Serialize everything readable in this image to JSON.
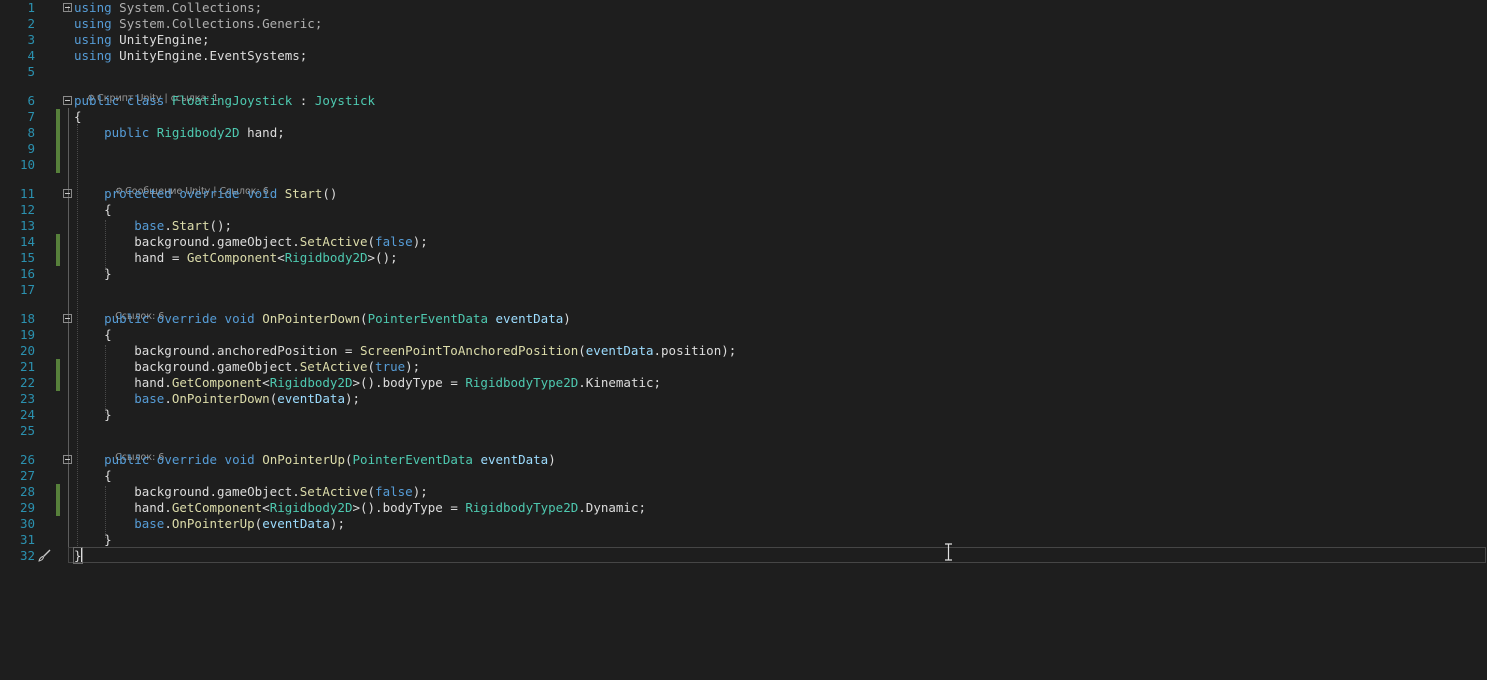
{
  "editor": {
    "lines": [
      {
        "n": "1",
        "tokens": [
          {
            "t": "using",
            "c": "kw"
          },
          {
            "t": " System.Collections;",
            "c": "dim"
          }
        ]
      },
      {
        "n": "2",
        "tokens": [
          {
            "t": "using",
            "c": "kw"
          },
          {
            "t": " System.Collections.Generic;",
            "c": "dim"
          }
        ]
      },
      {
        "n": "3",
        "tokens": [
          {
            "t": "using",
            "c": "kw"
          },
          {
            "t": " UnityEngine;",
            "c": ""
          }
        ]
      },
      {
        "n": "4",
        "tokens": [
          {
            "t": "using",
            "c": "kw"
          },
          {
            "t": " UnityEngine.EventSystems;",
            "c": ""
          }
        ]
      },
      {
        "n": "5",
        "tokens": []
      },
      {
        "n": "6",
        "tokens": [
          {
            "t": "public",
            "c": "kw"
          },
          {
            "t": " ",
            "c": ""
          },
          {
            "t": "class",
            "c": "kw"
          },
          {
            "t": " ",
            "c": ""
          },
          {
            "t": "FloatingJoystick",
            "c": "ty"
          },
          {
            "t": " : ",
            "c": ""
          },
          {
            "t": "Joystick",
            "c": "ty"
          }
        ]
      },
      {
        "n": "7",
        "tokens": [
          {
            "t": "{",
            "c": ""
          }
        ]
      },
      {
        "n": "8",
        "tokens": [
          {
            "t": "    ",
            "c": ""
          },
          {
            "t": "public",
            "c": "kw"
          },
          {
            "t": " ",
            "c": ""
          },
          {
            "t": "Rigidbody2D",
            "c": "ty"
          },
          {
            "t": " hand;",
            "c": ""
          }
        ]
      },
      {
        "n": "9",
        "tokens": []
      },
      {
        "n": "10",
        "tokens": []
      },
      {
        "n": "11",
        "tokens": [
          {
            "t": "    ",
            "c": ""
          },
          {
            "t": "protected",
            "c": "kw"
          },
          {
            "t": " ",
            "c": ""
          },
          {
            "t": "override",
            "c": "kw"
          },
          {
            "t": " ",
            "c": ""
          },
          {
            "t": "void",
            "c": "kw"
          },
          {
            "t": " ",
            "c": ""
          },
          {
            "t": "Start",
            "c": "fn"
          },
          {
            "t": "()",
            "c": ""
          }
        ]
      },
      {
        "n": "12",
        "tokens": [
          {
            "t": "    {",
            "c": ""
          }
        ]
      },
      {
        "n": "13",
        "tokens": [
          {
            "t": "        ",
            "c": ""
          },
          {
            "t": "base",
            "c": "kw"
          },
          {
            "t": ".",
            "c": ""
          },
          {
            "t": "Start",
            "c": "fn"
          },
          {
            "t": "();",
            "c": ""
          }
        ]
      },
      {
        "n": "14",
        "tokens": [
          {
            "t": "        background.gameObject.",
            "c": ""
          },
          {
            "t": "SetActive",
            "c": "fn"
          },
          {
            "t": "(",
            "c": ""
          },
          {
            "t": "false",
            "c": "kw"
          },
          {
            "t": ");",
            "c": ""
          }
        ]
      },
      {
        "n": "15",
        "tokens": [
          {
            "t": "        hand = ",
            "c": ""
          },
          {
            "t": "GetComponent",
            "c": "fn"
          },
          {
            "t": "<",
            "c": ""
          },
          {
            "t": "Rigidbody2D",
            "c": "ty"
          },
          {
            "t": ">();",
            "c": ""
          }
        ]
      },
      {
        "n": "16",
        "tokens": [
          {
            "t": "    }",
            "c": ""
          }
        ]
      },
      {
        "n": "17",
        "tokens": []
      },
      {
        "n": "18",
        "tokens": [
          {
            "t": "    ",
            "c": ""
          },
          {
            "t": "public",
            "c": "kw"
          },
          {
            "t": " ",
            "c": ""
          },
          {
            "t": "override",
            "c": "kw"
          },
          {
            "t": " ",
            "c": ""
          },
          {
            "t": "void",
            "c": "kw"
          },
          {
            "t": " ",
            "c": ""
          },
          {
            "t": "OnPointerDown",
            "c": "fn"
          },
          {
            "t": "(",
            "c": ""
          },
          {
            "t": "PointerEventData",
            "c": "ty"
          },
          {
            "t": " ",
            "c": ""
          },
          {
            "t": "eventData",
            "c": "pm"
          },
          {
            "t": ")",
            "c": ""
          }
        ]
      },
      {
        "n": "19",
        "tokens": [
          {
            "t": "    {",
            "c": ""
          }
        ]
      },
      {
        "n": "20",
        "tokens": [
          {
            "t": "        background.anchoredPosition = ",
            "c": ""
          },
          {
            "t": "ScreenPointToAnchoredPosition",
            "c": "fn"
          },
          {
            "t": "(",
            "c": ""
          },
          {
            "t": "eventData",
            "c": "pm"
          },
          {
            "t": ".position);",
            "c": ""
          }
        ]
      },
      {
        "n": "21",
        "tokens": [
          {
            "t": "        background.gameObject.",
            "c": ""
          },
          {
            "t": "SetActive",
            "c": "fn"
          },
          {
            "t": "(",
            "c": ""
          },
          {
            "t": "true",
            "c": "kw"
          },
          {
            "t": ");",
            "c": ""
          }
        ]
      },
      {
        "n": "22",
        "tokens": [
          {
            "t": "        hand.",
            "c": ""
          },
          {
            "t": "GetComponent",
            "c": "fn"
          },
          {
            "t": "<",
            "c": ""
          },
          {
            "t": "Rigidbody2D",
            "c": "ty"
          },
          {
            "t": ">().bodyType = ",
            "c": ""
          },
          {
            "t": "RigidbodyType2D",
            "c": "ty"
          },
          {
            "t": ".Kinematic;",
            "c": ""
          }
        ]
      },
      {
        "n": "23",
        "tokens": [
          {
            "t": "        ",
            "c": ""
          },
          {
            "t": "base",
            "c": "kw"
          },
          {
            "t": ".",
            "c": ""
          },
          {
            "t": "OnPointerDown",
            "c": "fn"
          },
          {
            "t": "(",
            "c": ""
          },
          {
            "t": "eventData",
            "c": "pm"
          },
          {
            "t": ");",
            "c": ""
          }
        ]
      },
      {
        "n": "24",
        "tokens": [
          {
            "t": "    }",
            "c": ""
          }
        ]
      },
      {
        "n": "25",
        "tokens": []
      },
      {
        "n": "26",
        "tokens": [
          {
            "t": "    ",
            "c": ""
          },
          {
            "t": "public",
            "c": "kw"
          },
          {
            "t": " ",
            "c": ""
          },
          {
            "t": "override",
            "c": "kw"
          },
          {
            "t": " ",
            "c": ""
          },
          {
            "t": "void",
            "c": "kw"
          },
          {
            "t": " ",
            "c": ""
          },
          {
            "t": "OnPointerUp",
            "c": "fn"
          },
          {
            "t": "(",
            "c": ""
          },
          {
            "t": "PointerEventData",
            "c": "ty"
          },
          {
            "t": " ",
            "c": ""
          },
          {
            "t": "eventData",
            "c": "pm"
          },
          {
            "t": ")",
            "c": ""
          }
        ]
      },
      {
        "n": "27",
        "tokens": [
          {
            "t": "    {",
            "c": ""
          }
        ]
      },
      {
        "n": "28",
        "tokens": [
          {
            "t": "        background.gameObject.",
            "c": ""
          },
          {
            "t": "SetActive",
            "c": "fn"
          },
          {
            "t": "(",
            "c": ""
          },
          {
            "t": "false",
            "c": "kw"
          },
          {
            "t": ");",
            "c": ""
          }
        ]
      },
      {
        "n": "29",
        "tokens": [
          {
            "t": "        hand.",
            "c": ""
          },
          {
            "t": "GetComponent",
            "c": "fn"
          },
          {
            "t": "<",
            "c": ""
          },
          {
            "t": "Rigidbody2D",
            "c": "ty"
          },
          {
            "t": ">().bodyType = ",
            "c": ""
          },
          {
            "t": "RigidbodyType2D",
            "c": "ty"
          },
          {
            "t": ".Dynamic;",
            "c": ""
          }
        ]
      },
      {
        "n": "30",
        "tokens": [
          {
            "t": "        ",
            "c": ""
          },
          {
            "t": "base",
            "c": "kw"
          },
          {
            "t": ".",
            "c": ""
          },
          {
            "t": "OnPointerUp",
            "c": "fn"
          },
          {
            "t": "(",
            "c": ""
          },
          {
            "t": "eventData",
            "c": "pm"
          },
          {
            "t": ");",
            "c": ""
          }
        ]
      },
      {
        "n": "31",
        "tokens": [
          {
            "t": "    }",
            "c": ""
          }
        ]
      },
      {
        "n": "32",
        "tokens": [
          {
            "t": "}",
            "c": ""
          }
        ]
      }
    ],
    "codelens": {
      "class_hint": "Скрипт Unity | ссылка: 1",
      "start_hint": "Сообщение Unity | Ссылок: 6",
      "pointer_down_hint": "Ссылок: 6",
      "pointer_up_hint": "Ссылок: 6"
    },
    "icons": {
      "unity_script": "unity-gear-icon",
      "quick_action": "paintbrush-icon",
      "mouse_cursor": "i-beam-cursor-icon"
    },
    "colors": {
      "background": "#1e1e1e",
      "line_number": "#2b91af",
      "keyword": "#569cd6",
      "type": "#4ec9b0",
      "method": "#dcdcaa",
      "parameter": "#9cdcfe",
      "changed_marker": "#57803b"
    }
  }
}
